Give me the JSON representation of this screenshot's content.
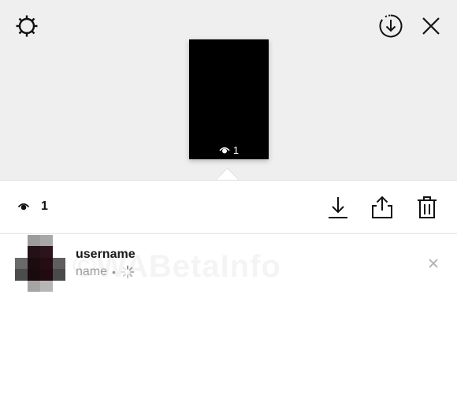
{
  "header": {
    "icons": [
      "gear-icon",
      "download-circle-icon",
      "close-icon"
    ]
  },
  "story": {
    "views": "1"
  },
  "actions": {
    "views": "1",
    "icons": [
      "eye-icon",
      "download-icon",
      "share-icon",
      "trash-icon"
    ]
  },
  "viewers": [
    {
      "username": "username",
      "name": "name",
      "separator": "•"
    }
  ],
  "watermark": "©WABetaInfo",
  "colors": {
    "top_background": "#efefef",
    "background": "#ffffff",
    "thumbnail": "#000000",
    "muted_text": "#9a9a9a"
  }
}
